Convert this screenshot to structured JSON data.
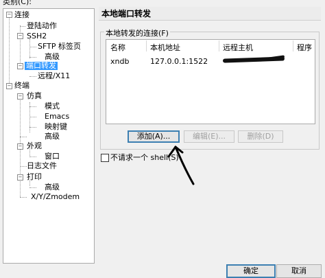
{
  "dialog": {
    "category_label": "类别(C):"
  },
  "tree": {
    "connection": "连接",
    "login_actions": "登陆动作",
    "ssh2": "SSH2",
    "sftp_tab": "SFTP 标签页",
    "advanced1": "高级",
    "port_forwarding": "端口转发",
    "remote_x11": "远程/X11",
    "terminal": "终端",
    "emulation": "仿真",
    "modes": "模式",
    "emacs": "Emacs",
    "mapped_keys": "映射键",
    "advanced2": "高级",
    "appearance": "外观",
    "window": "窗口",
    "log_file": "日志文件",
    "printing": "打印",
    "advanced3": "高级",
    "xyz_modem": "X/Y/Zmodem"
  },
  "panel": {
    "title": "本地端口转发",
    "group_label": "本地转发的连接(F)",
    "columns": [
      "名称",
      "本机地址",
      "远程主机",
      "程序"
    ],
    "rows": [
      {
        "name": "xndb",
        "local": "127.0.0.1:1522",
        "remote": "",
        "program": ""
      }
    ],
    "add_button": "添加(A)...",
    "edit_button": "编辑(E)...",
    "delete_button": "删除(D)",
    "checkbox_label": "不请求一个 shell(S)"
  },
  "footer": {
    "ok_button": "确定",
    "cancel_button": "取消"
  }
}
